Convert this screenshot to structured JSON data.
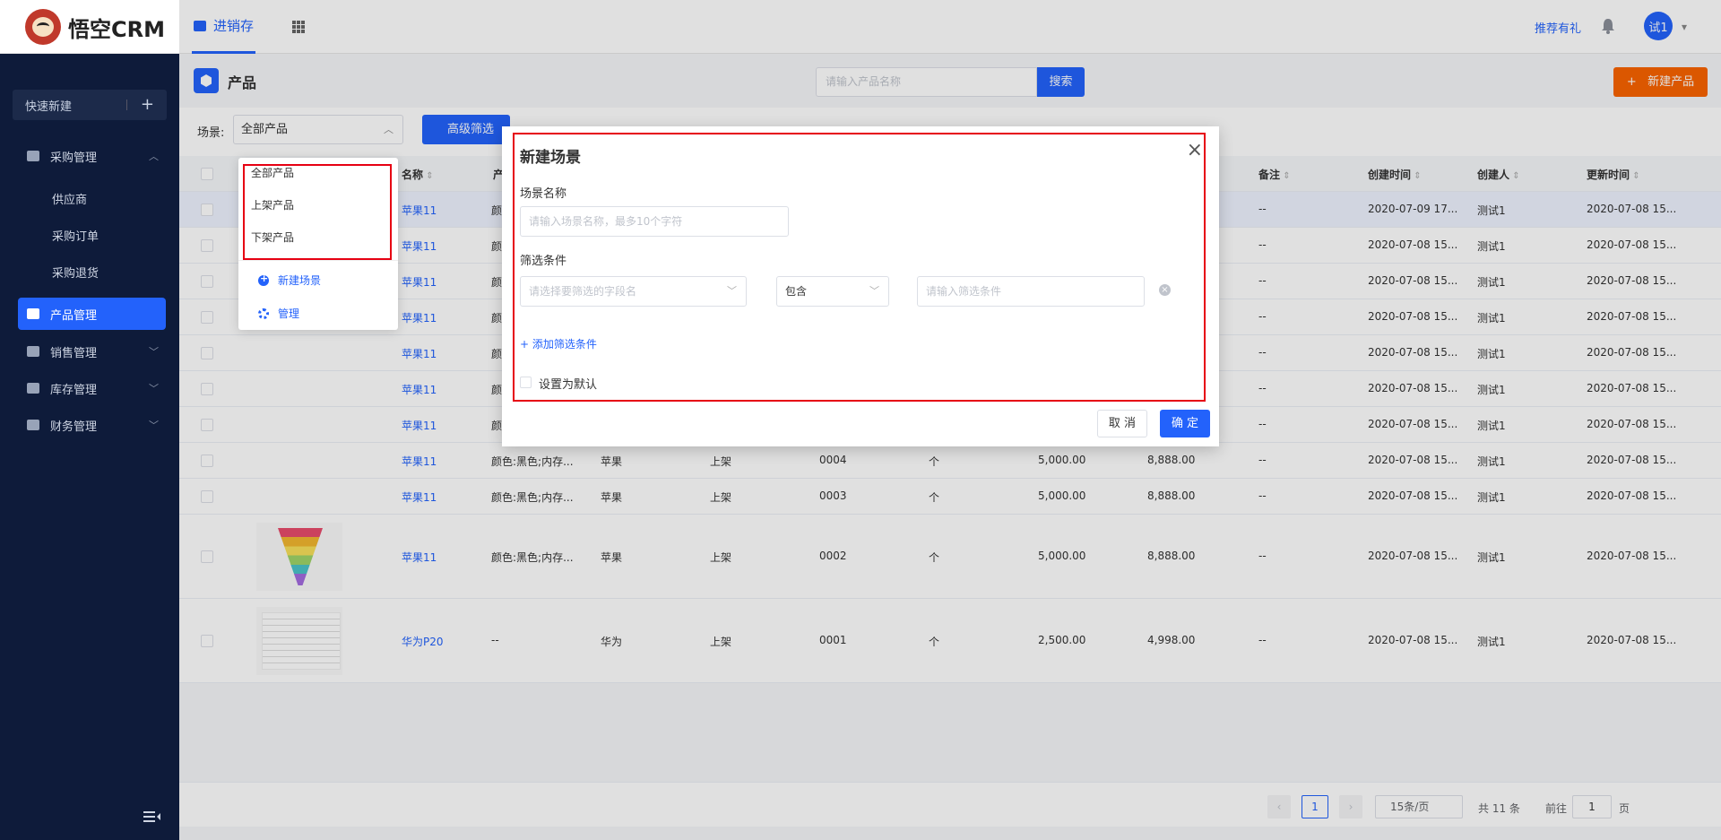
{
  "app": {
    "logo_text": "悟空CRM",
    "nav_tab": "进销存",
    "recommend": "推荐有礼",
    "avatar": "试1"
  },
  "sidebar": {
    "quick_new": "快速新建",
    "menu": [
      {
        "label": "采购管理",
        "expanded": true
      },
      {
        "label": "产品管理",
        "active": true
      },
      {
        "label": "销售管理"
      },
      {
        "label": "库存管理"
      },
      {
        "label": "财务管理"
      }
    ],
    "sub_items": [
      "供应商",
      "采购订单",
      "采购退货"
    ]
  },
  "page": {
    "title": "产品",
    "search_placeholder": "请输入产品名称",
    "search_button": "搜索",
    "new_button": "新建产品",
    "scene_label": "场景:",
    "scene_value": "全部产品",
    "filter_button": "高级筛选"
  },
  "table": {
    "headers": [
      "名称",
      "产",
      "备注",
      "创建时间",
      "创建人",
      "更新时间"
    ],
    "rows": [
      {
        "name": "苹果11",
        "col2": "颜",
        "brand": "",
        "status": "",
        "code": "",
        "unit": "",
        "price": "",
        "cost": "",
        "remark": "--",
        "created": "2020-07-09 17...",
        "creator": "测试1",
        "updated": "2020-07-08 15..."
      },
      {
        "name": "苹果11",
        "col2": "颜",
        "brand": "",
        "status": "",
        "code": "",
        "unit": "",
        "price": "",
        "cost": "",
        "remark": "--",
        "created": "2020-07-08 15...",
        "creator": "测试1",
        "updated": "2020-07-08 15..."
      },
      {
        "name": "苹果11",
        "col2": "颜",
        "brand": "",
        "status": "",
        "code": "",
        "unit": "",
        "price": "",
        "cost": "",
        "remark": "--",
        "created": "2020-07-08 15...",
        "creator": "测试1",
        "updated": "2020-07-08 15..."
      },
      {
        "name": "苹果11",
        "col2": "颜",
        "brand": "",
        "status": "",
        "code": "",
        "unit": "",
        "price": "",
        "cost": "",
        "remark": "--",
        "created": "2020-07-08 15...",
        "creator": "测试1",
        "updated": "2020-07-08 15..."
      },
      {
        "name": "苹果11",
        "col2": "颜",
        "brand": "",
        "status": "",
        "code": "",
        "unit": "",
        "price": "",
        "cost": "",
        "remark": "--",
        "created": "2020-07-08 15...",
        "creator": "测试1",
        "updated": "2020-07-08 15..."
      },
      {
        "name": "苹果11",
        "col2": "颜",
        "brand": "",
        "status": "",
        "code": "",
        "unit": "",
        "price": "",
        "cost": "",
        "remark": "--",
        "created": "2020-07-08 15...",
        "creator": "测试1",
        "updated": "2020-07-08 15..."
      },
      {
        "name": "苹果11",
        "col2": "颜",
        "brand": "",
        "status": "",
        "code": "",
        "unit": "",
        "price": "",
        "cost": "",
        "remark": "--",
        "created": "2020-07-08 15...",
        "creator": "测试1",
        "updated": "2020-07-08 15..."
      },
      {
        "name": "苹果11",
        "col2": "颜色:黑色;内存...",
        "brand": "苹果",
        "status": "上架",
        "code": "0004",
        "unit": "个",
        "price": "5,000.00",
        "cost": "8,888.00",
        "remark": "--",
        "created": "2020-07-08 15...",
        "creator": "测试1",
        "updated": "2020-07-08 15..."
      },
      {
        "name": "苹果11",
        "col2": "颜色:黑色;内存...",
        "brand": "苹果",
        "status": "上架",
        "code": "0003",
        "unit": "个",
        "price": "5,000.00",
        "cost": "8,888.00",
        "remark": "--",
        "created": "2020-07-08 15...",
        "creator": "测试1",
        "updated": "2020-07-08 15..."
      },
      {
        "name": "苹果11",
        "col2": "颜色:黑色;内存...",
        "brand": "苹果",
        "status": "上架",
        "code": "0002",
        "unit": "个",
        "price": "5,000.00",
        "cost": "8,888.00",
        "remark": "--",
        "created": "2020-07-08 15...",
        "creator": "测试1",
        "updated": "2020-07-08 15..."
      },
      {
        "name": "华为P20",
        "col2": "--",
        "brand": "华为",
        "status": "上架",
        "code": "0001",
        "unit": "个",
        "price": "2,500.00",
        "cost": "4,998.00",
        "remark": "--",
        "created": "2020-07-08 15...",
        "creator": "测试1",
        "updated": "2020-07-08 15..."
      }
    ]
  },
  "pager": {
    "page": "1",
    "page_size": "15条/页",
    "total": "共 11 条",
    "goto_label": "前往",
    "goto_value": "1",
    "page_unit": "页"
  },
  "scene_dropdown": {
    "items": [
      "全部产品",
      "上架产品",
      "下架产品"
    ],
    "new_scene": "新建场景",
    "manage": "管理"
  },
  "modal": {
    "title": "新建场景",
    "name_label": "场景名称",
    "name_placeholder": "请输入场景名称，最多10个字符",
    "filter_label": "筛选条件",
    "field_placeholder": "请选择要筛选的字段名",
    "operator_value": "包含",
    "value_placeholder": "请输入筛选条件",
    "add_condition": "+ 添加筛选条件",
    "default_label": "设置为默认",
    "cancel": "取 消",
    "ok": "确 定"
  },
  "colors": {
    "primary": "#2362fb",
    "accent_orange": "#fa6400",
    "sidebar_bg": "#0e1b3a",
    "highlight_red": "#e60012"
  }
}
